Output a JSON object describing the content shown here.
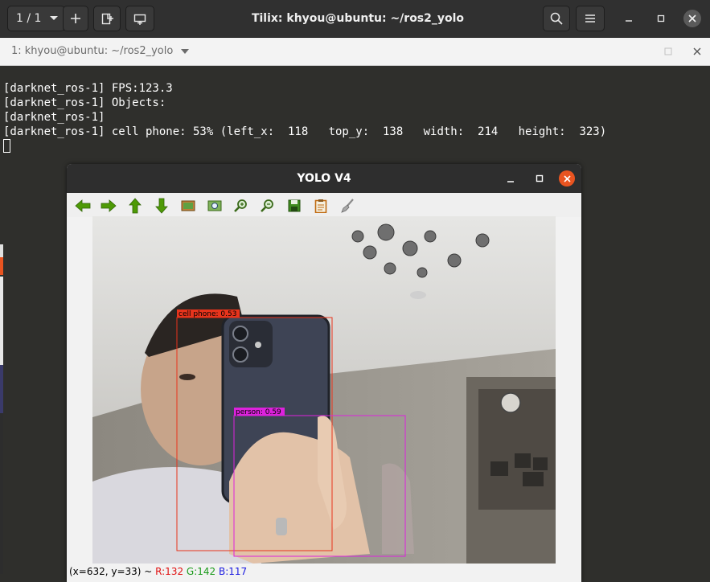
{
  "tilix": {
    "session_counter": "1 / 1",
    "title": "Tilix: khyou@ubuntu: ~/ros2_yolo",
    "terminal_tab_label": "1: khyou@ubuntu: ~/ros2_yolo"
  },
  "terminal": {
    "lines": [
      "[darknet_ros-1] FPS:123.3",
      "[darknet_ros-1] Objects:",
      "[darknet_ros-1]",
      "[darknet_ros-1] cell phone: 53% (left_x:  118   top_y:  138   width:  214   height:  323)"
    ]
  },
  "yolo_window": {
    "title": "YOLO V4",
    "toolbar": [
      "arrow-left-icon",
      "arrow-right-icon",
      "arrow-up-icon",
      "arrow-down-icon",
      "image-icon",
      "zoom-fit-icon",
      "zoom-in-icon",
      "zoom-out-icon",
      "save-icon",
      "properties-icon",
      "brush-icon"
    ],
    "detections": [
      {
        "label": "cell phone: 0.53",
        "color": "#e8341c"
      },
      {
        "label": "person: 0.59",
        "color": "#dd22dd"
      }
    ],
    "status_coords": "(x=632, y=33) ~ ",
    "status_r": "R:132",
    "status_g": "G:142",
    "status_b": "B:117"
  },
  "colors": {
    "close_button": "#e95420",
    "terminal_bg": "#2f2f2c"
  }
}
